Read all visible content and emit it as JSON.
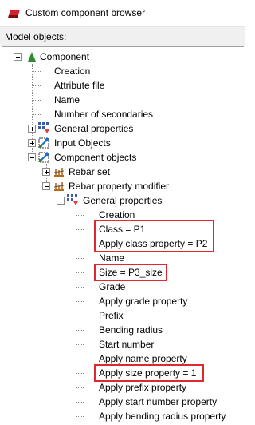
{
  "window": {
    "title": "Custom component browser",
    "panel_label": "Model objects:"
  },
  "tree": {
    "root": "Component",
    "component_children": [
      "Creation",
      "Attribute file",
      "Name",
      "Number of secondaries"
    ],
    "general_properties": "General properties",
    "input_objects": "Input Objects",
    "component_objects": "Component objects",
    "rebar_set": "Rebar set",
    "rebar_property_modifier": "Rebar property modifier",
    "modifier_general_properties": "General properties",
    "modifier_items": [
      "Creation",
      "Class = P1",
      "Apply class property = P2",
      "Name",
      "Size = P3_size",
      "Grade",
      "Apply grade property",
      "Prefix",
      "Bending radius",
      "Start number",
      "Apply name property",
      "Apply size property = 1",
      "Apply prefix property",
      "Apply start number property",
      "Apply bending radius property"
    ]
  },
  "colors": {
    "highlight": "#e0282e",
    "root_icon": "#2e8b2e"
  }
}
